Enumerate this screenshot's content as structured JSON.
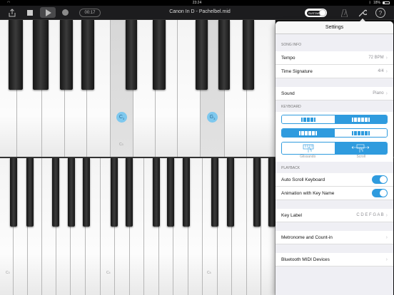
{
  "status_bar": {
    "time": "23:24",
    "battery": "18%"
  },
  "toolbar": {
    "elapsed": "00:17",
    "song_title": "Canon In D - Pachelbel.mid",
    "sustain_label": "SUSTAIN"
  },
  "keyboard_top": {
    "highlight_1": "C",
    "highlight_2": "G",
    "octave_label": "C",
    "octave_sub": "3"
  },
  "keyboard_bottom": {
    "octave_labels": [
      {
        "main": "C",
        "sub": "3"
      },
      {
        "main": "C",
        "sub": "4"
      },
      {
        "main": "C",
        "sub": "5"
      }
    ]
  },
  "settings": {
    "title": "Settings",
    "song_info_header": "SONG INFO",
    "tempo_label": "Tempo",
    "tempo_value": "72 BPM",
    "time_sig_label": "Time Signature",
    "time_sig_value": "4/4",
    "sound_label": "Sound",
    "sound_value": "Piano",
    "keyboard_header": "KEYBOARD",
    "glissando_label": "Glissando",
    "scroll_label": "Scroll",
    "playback_header": "PLAYBACK",
    "auto_scroll_label": "Auto Scroll Keyboard",
    "auto_scroll_on": true,
    "animation_label": "Animation with Key Name",
    "animation_on": true,
    "key_label_label": "Key Label",
    "key_label_value": "C D E F G A B",
    "metronome_label": "Metronome and Count-in",
    "bluetooth_label": "Bluetooth MIDI Devices"
  },
  "colors": {
    "accent": "#2f9bde",
    "note_highlight": "#7ec8ee"
  }
}
